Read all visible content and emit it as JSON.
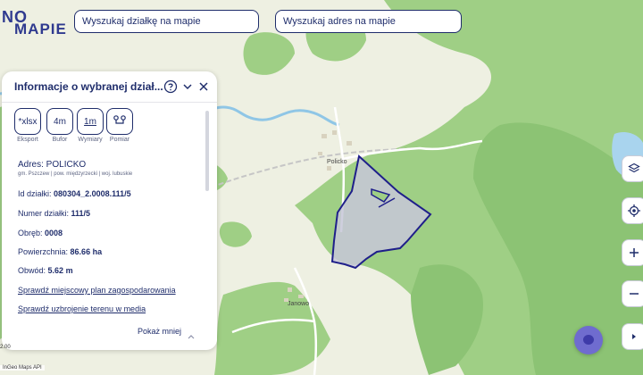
{
  "app": {
    "logo_top": "NO",
    "logo_bottom": "MAPIE"
  },
  "search": {
    "parcel_placeholder": "Wyszukaj działkę na mapie",
    "address_placeholder": "Wyszukaj adres na mapie"
  },
  "panel": {
    "title": "Informacje o wybranej dział...",
    "tools": [
      {
        "label": "*xlsx",
        "caption": "Eksport"
      },
      {
        "label": "4m",
        "caption": "Bufor"
      },
      {
        "label": "1m",
        "caption": "Wymiary"
      },
      {
        "label": "",
        "caption": "Pomiar"
      }
    ],
    "address_label": "Adres: POLICKO",
    "address_sub": "gm. Pszczew | pow. międzyrzecki | woj. lubuskie",
    "parcel_id_label": "Id działki:",
    "parcel_id_value": "080304_2.0008.111/5",
    "parcel_number_label": "Numer działki:",
    "parcel_number_value": "111/5",
    "precinct_label": "Obręb:",
    "precinct_value": "0008",
    "area_label": "Powierzchnia:",
    "area_value": "86.66 ha",
    "perimeter_label": "Obwód:",
    "perimeter_value": "5.62 m",
    "link_plan": "Sprawdź miejscowy plan zagospodarowania",
    "link_utilities": "Sprawdź uzbrojenie terenu w media",
    "show_less": "Pokaż mniej"
  },
  "map": {
    "places": [
      "Policko",
      "Janowo"
    ],
    "attribution": "InGeo Maps API",
    "scale_text": "2.00",
    "colors": {
      "forest": "#9fcf85",
      "forest_dark": "#8cc374",
      "field": "#eef0e2",
      "parcel_fill": "#c7c7d8",
      "parcel_stroke": "#1f1f8a",
      "water": "#a9d4ee",
      "river": "#8fc6e6",
      "railway": "#c6c6c6",
      "road": "#ffffff",
      "brand": "#1f2d6b",
      "chat": "#6f6ccf"
    }
  },
  "icons": {
    "help": "help-circle-icon",
    "collapse": "chevron-down-icon",
    "close": "close-icon",
    "measure": "measure-points-icon",
    "layers": "layers-icon",
    "locate": "locate-icon",
    "zoom_in": "plus-icon",
    "zoom_out": "minus-icon",
    "expand": "chevron-right-icon",
    "chat": "chat-icon"
  }
}
